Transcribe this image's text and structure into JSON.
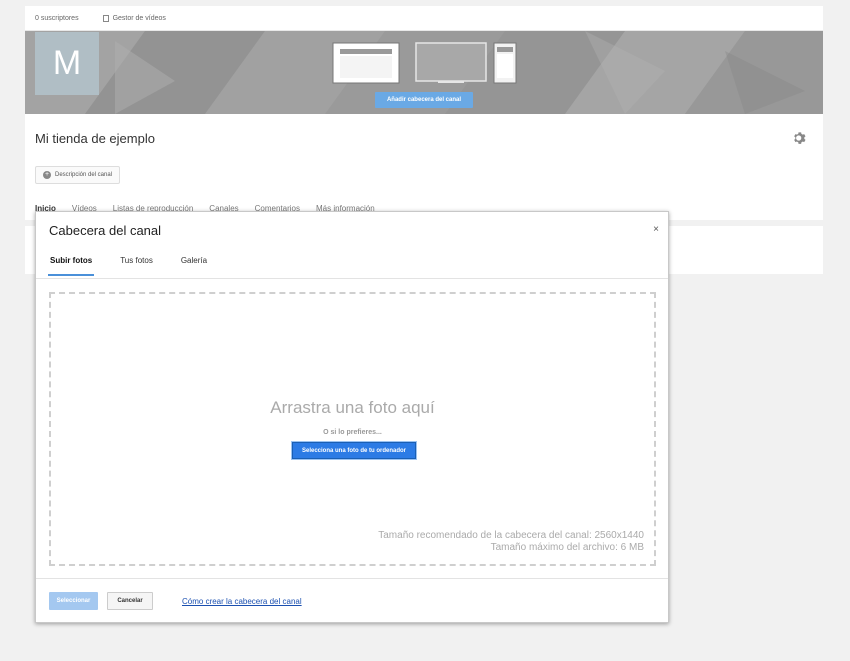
{
  "topbar": {
    "subscribers": "0 suscriptores",
    "video_manager": "Gestor de vídeos"
  },
  "banner": {
    "avatar_letter": "M",
    "add_header_button": "Añadir cabecera del canal"
  },
  "channel": {
    "title": "Mi tienda de ejemplo",
    "description_button": "Descripción del canal",
    "tabs": [
      "Inicio",
      "Vídeos",
      "Listas de reproducción",
      "Canales",
      "Comentarios",
      "Más información"
    ]
  },
  "modal": {
    "title": "Cabecera del canal",
    "close": "×",
    "tabs": [
      "Subir fotos",
      "Tus fotos",
      "Galería"
    ],
    "active_tab": "Subir fotos",
    "dropzone": {
      "main_text": "Arrastra una foto aquí",
      "or_text": "O si lo prefieres...",
      "select_button": "Selecciona una foto de tu ordenador",
      "hint_size": "Tamaño recomendado de la cabecera del canal: 2560x1440",
      "hint_max": "Tamaño máximo del archivo: 6 MB"
    },
    "footer": {
      "select_button": "Seleccionar",
      "cancel_button": "Cancelar",
      "help_link": "Cómo crear la cabecera del canal"
    }
  },
  "colors": {
    "accent": "#2c7be5",
    "accent_disabled": "#a4c8f0",
    "banner_bg": "#9a9a9a",
    "avatar_bg": "#b0bec5",
    "link": "#1a4fb0"
  }
}
